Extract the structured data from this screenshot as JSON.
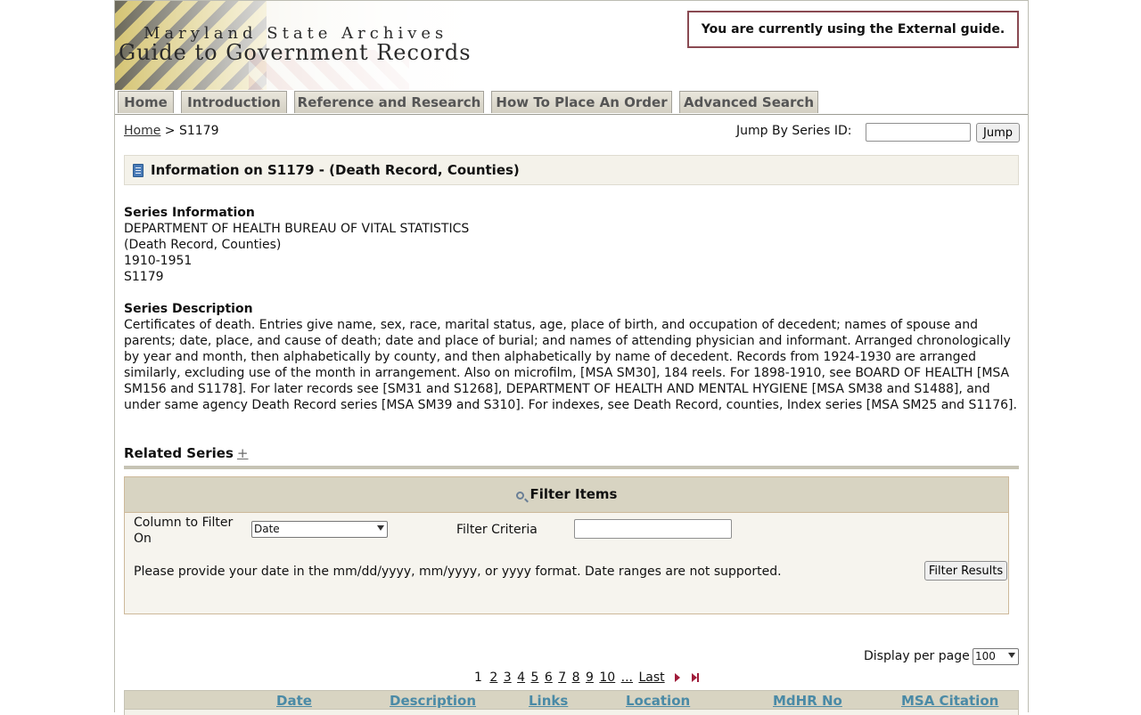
{
  "header": {
    "brand_top": "Maryland State Archives",
    "brand_main": "Guide to Government Records",
    "guide_notice": "You are currently using the External guide."
  },
  "tabs": [
    {
      "label": "Home"
    },
    {
      "label": "Introduction"
    },
    {
      "label": "Reference and Research"
    },
    {
      "label": "How To Place An Order"
    },
    {
      "label": "Advanced Search"
    }
  ],
  "breadcrumb": {
    "home": "Home",
    "separator": ">",
    "current": "S1179"
  },
  "jump": {
    "label": "Jump By Series ID:",
    "value": "",
    "button": "Jump"
  },
  "info": {
    "title": "Information on S1179 - (Death Record, Counties)",
    "icon": "book-icon"
  },
  "series": {
    "info_heading": "Series Information",
    "agency": "DEPARTMENT OF HEALTH BUREAU OF VITAL STATISTICS",
    "name": "(Death Record, Counties)",
    "dates": "1910-1951",
    "id": "S1179",
    "desc_heading": "Series Description",
    "description": "Certificates of death. Entries give name, sex, race, marital status, age, place of birth, and occupation of decedent; names of spouse and parents; date, place, and cause of death; date and place of burial; and names of attending physician and informant. Arranged chronologically by year and month, then alphabetically by county, and then alphabetically by name of decedent. Records from 1924-1930 are arranged similarly, excluding use of the month in arrangement. Also on microfilm, [MSA SM30], 184 reels. For 1898-1910, see BOARD OF HEALTH [MSA SM156 and S1178]. For later records see [SM31 and S1268], DEPARTMENT OF HEALTH AND MENTAL HYGIENE [MSA SM38 and S1488], and under same agency Death Record series [MSA SM39 and S310]. For indexes, see Death Record, counties, Index series [MSA SM25 and S1176].",
    "related_label": "Related Series",
    "related_toggle": "+"
  },
  "filter": {
    "title": "Filter Items",
    "column_label": "Column to Filter On",
    "column_value": "Date",
    "criteria_label": "Filter Criteria",
    "criteria_value": "",
    "hint": "Please provide your date in the mm/dd/yyyy, mm/yyyy, or yyyy format. Date ranges are not supported.",
    "button": "Filter Results"
  },
  "pager": {
    "display_label": "Display per page",
    "per_page": "100",
    "current": "1",
    "pages": [
      "2",
      "3",
      "4",
      "5",
      "6",
      "7",
      "8",
      "9",
      "10"
    ],
    "ellipsis": "...",
    "last": "Last"
  },
  "table": {
    "columns": [
      "Date",
      "Description",
      "Links",
      "Location",
      "MdHR No",
      "MSA Citation"
    ]
  }
}
